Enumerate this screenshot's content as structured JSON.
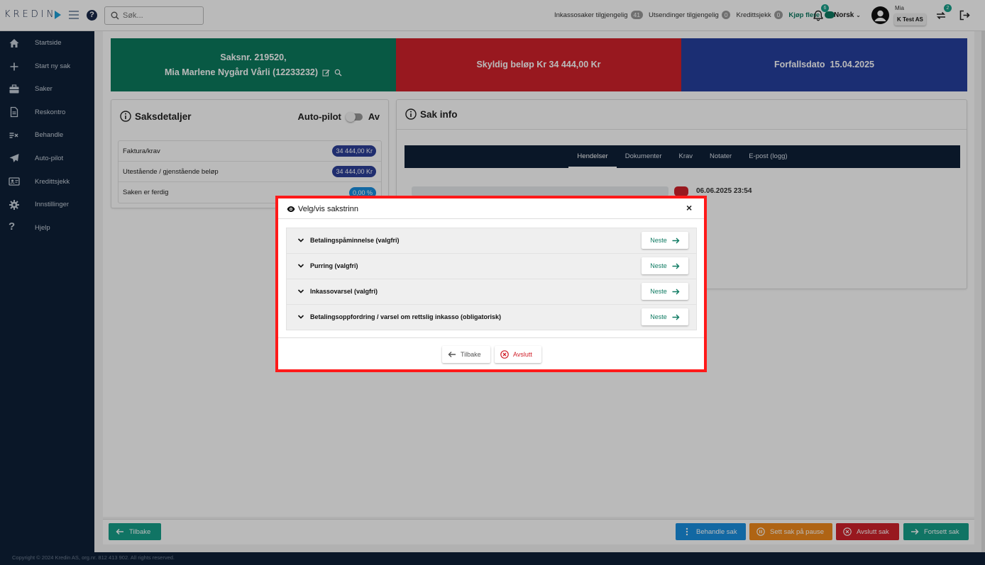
{
  "topbar": {
    "logo_text": "KREDIN",
    "search_placeholder": "Søk...",
    "stats": [
      {
        "label": "Inkassosaker tilgjengelig",
        "count": "41"
      },
      {
        "label": "Utsendinger tilgjengelig",
        "count": "0"
      },
      {
        "label": "Kredittsjekk",
        "count": "0"
      }
    ],
    "buy_more": "Kjøp flere",
    "notification_count": "6",
    "language": "Norsk",
    "user_name": "Mia",
    "company": "K Test AS",
    "switch_count": "2"
  },
  "sidebar": {
    "items": [
      {
        "label": "Startside",
        "icon": "home-icon"
      },
      {
        "label": "Start ny sak",
        "icon": "plus-icon"
      },
      {
        "label": "Saker",
        "icon": "briefcase-icon"
      },
      {
        "label": "Reskontro",
        "icon": "document-icon"
      },
      {
        "label": "Behandle",
        "icon": "process-icon"
      },
      {
        "label": "Auto-pilot",
        "icon": "airplane-icon"
      },
      {
        "label": "Kredittsjekk",
        "icon": "id-card-icon"
      },
      {
        "label": "Innstillinger",
        "icon": "gear-icon"
      },
      {
        "label": "Hjelp",
        "icon": "question-icon"
      }
    ]
  },
  "banners": {
    "case_number": "Saksnr. 219520,",
    "debtor": "Mia Marlene Nygård Vårli (12233232)",
    "amount_owed": "Skyldig beløp Kr 34 444,00 Kr",
    "due_date": "Forfallsdato  15.04.2025"
  },
  "saksdetaljer": {
    "title": "Saksdetaljer",
    "autopilot_label": "Auto-pilot",
    "autopilot_state": "Av",
    "rows": [
      {
        "label": "Faktura/krav",
        "value": "34 444,00 Kr"
      },
      {
        "label": "Utestående / gjenstående beløp",
        "value": "34 444,00 Kr"
      },
      {
        "label": "Saken er ferdig",
        "value": "0,00 %"
      }
    ]
  },
  "sakinfo": {
    "title": "Sak info",
    "tabs": [
      "Hendelser",
      "Dokumenter",
      "Krav",
      "Notater",
      "E-post (logg)"
    ],
    "event_time": "06.06.2025 23:54"
  },
  "bottom": {
    "back": "Tilbake",
    "process": "Behandle sak",
    "pause": "Sett sak på pause",
    "close": "Avslutt sak",
    "continue": "Fortsett sak"
  },
  "footer": "Copyright © 2024 Kredin AS, org.nr. 812 413 902. All rights reserved.",
  "modal": {
    "title": "Velg/vis sakstrinn",
    "close": "×",
    "steps": [
      {
        "label": "Betalingspåminnelse (valgfri)",
        "button": "Neste"
      },
      {
        "label": "Purring (valgfri)",
        "button": "Neste"
      },
      {
        "label": "Inkassovarsel (valgfri)",
        "button": "Neste"
      },
      {
        "label": "Betalingsoppfordring / varsel om rettslig inkasso (obligatorisk)",
        "button": "Neste"
      }
    ],
    "back": "Tilbake",
    "cancel": "Avslutt"
  }
}
